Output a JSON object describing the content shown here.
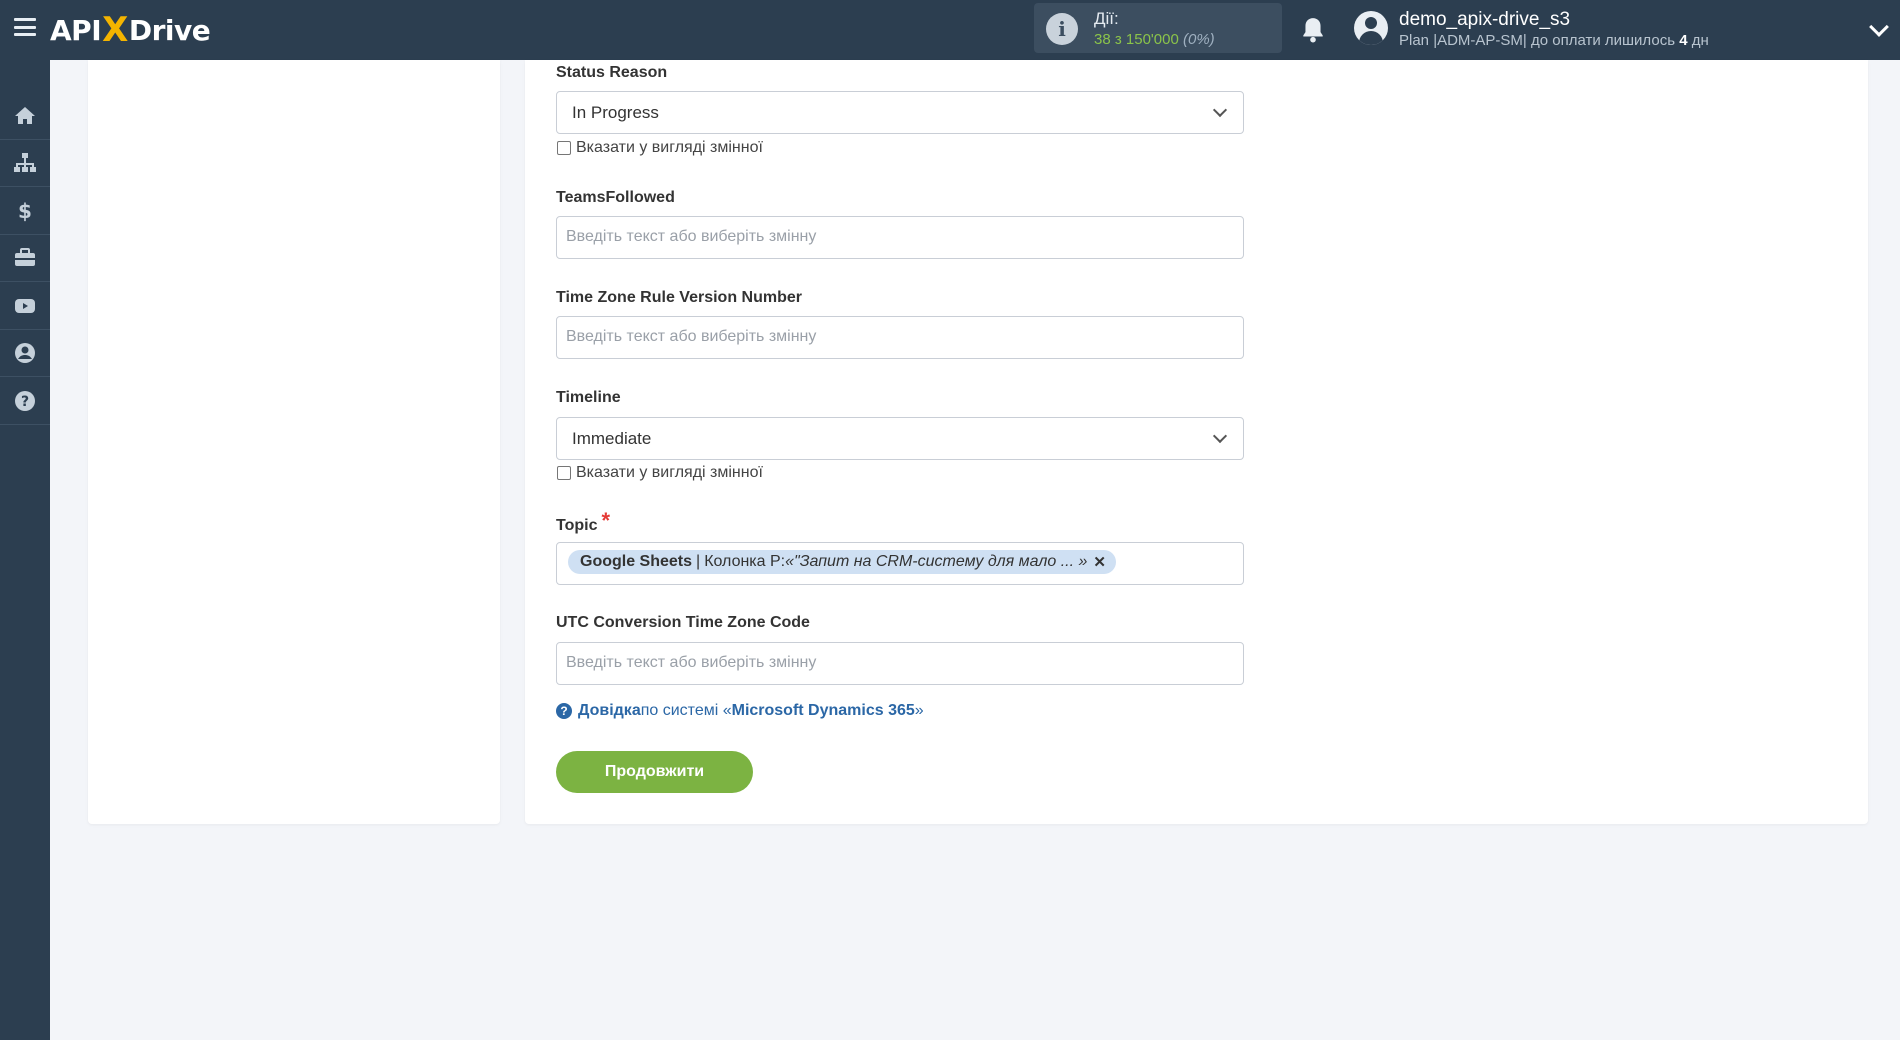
{
  "app": {
    "logo_left": "API",
    "logo_x": "X",
    "logo_right": "Drive"
  },
  "header": {
    "actions_label": "Дії:",
    "actions_used": "38",
    "actions_of": " з ",
    "actions_total": "150'000",
    "actions_percent": "(0%)",
    "user_name": "demo_apix-drive_s3",
    "plan_prefix": "Plan |ADM-AP-SM| до оплати лишилось ",
    "plan_days": "4",
    "plan_suffix": " дн"
  },
  "sidebar": {
    "items": [
      "home-icon",
      "sitemap-icon",
      "dollar-icon",
      "briefcase-icon",
      "youtube-icon",
      "user-circle-icon",
      "question-circle-icon"
    ]
  },
  "form": {
    "status_reason": {
      "label": "Status Reason",
      "value": "In Progress",
      "checkbox_label": "Вказати у вигляді змінної"
    },
    "teams_followed": {
      "label": "TeamsFollowed",
      "placeholder": "Введіть текст або виберіть змінну"
    },
    "time_zone_rule": {
      "label": "Time Zone Rule Version Number",
      "placeholder": "Введіть текст або виберіть змінну"
    },
    "timeline": {
      "label": "Timeline",
      "value": "Immediate",
      "checkbox_label": "Вказати у вигляді змінної"
    },
    "topic": {
      "label": "Topic",
      "required_mark": "*",
      "tag_source": "Google Sheets",
      "tag_separator": "|",
      "tag_column": "Колонка P: ",
      "tag_value": "«\"Запит на CRM-систему для мало ... »",
      "tag_remove": "✕"
    },
    "utc_conversion": {
      "label": "UTC Conversion Time Zone Code",
      "placeholder": "Введіть текст або виберіть змінну"
    },
    "help": {
      "icon": "question-circle-icon",
      "link": "Довідка",
      "middle": " по системі «",
      "system": "Microsoft Dynamics 365",
      "end": "»"
    },
    "continue_label": "Продовжити"
  },
  "colors": {
    "topbar": "#2c3e50",
    "accent_green": "#7cb342",
    "link_blue": "#2b67a6",
    "logo_x": "#f4b400"
  }
}
